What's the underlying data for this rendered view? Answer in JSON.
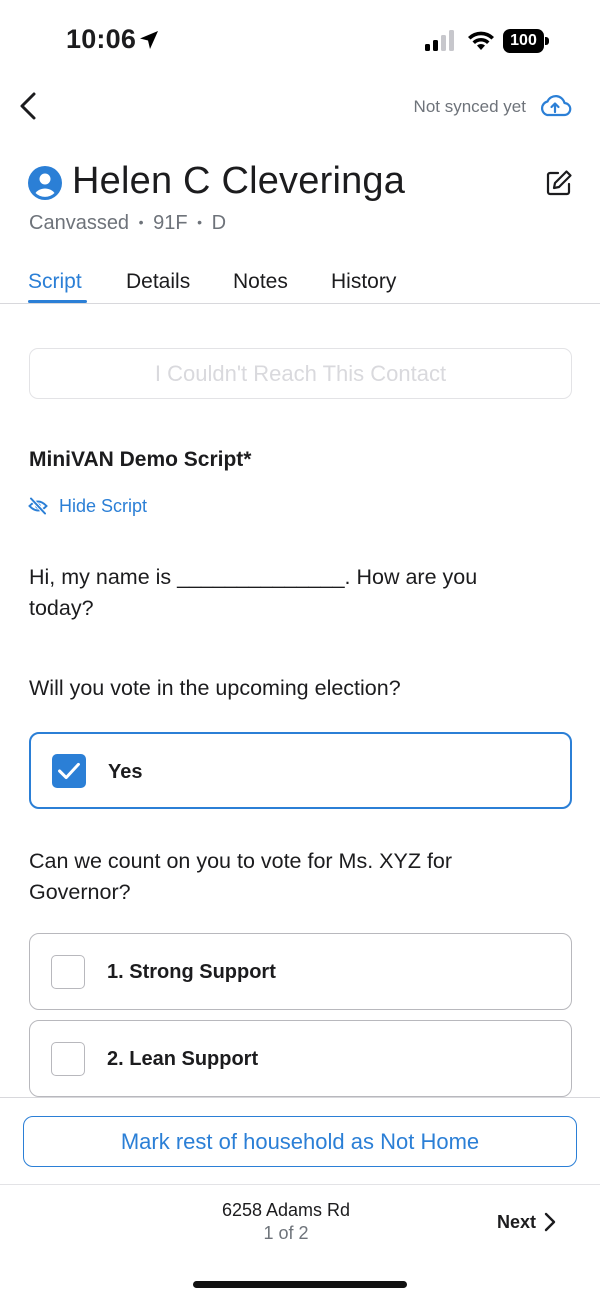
{
  "status_bar": {
    "time": "10:06",
    "battery": "100",
    "location_icon": "location-arrow-icon",
    "signal_icon": "cellular-signal-icon",
    "wifi_icon": "wifi-icon"
  },
  "nav": {
    "back_icon": "chevron-left-icon",
    "sync_status": "Not synced yet",
    "sync_icon": "cloud-upload-icon"
  },
  "contact": {
    "avatar_icon": "user-circle-icon",
    "name": "Helen C Cleveringa",
    "status": "Canvassed",
    "age_gender": "91F",
    "party": "D",
    "separator": "•",
    "edit_icon": "edit-icon"
  },
  "tabs": [
    {
      "label": "Script",
      "active": true
    },
    {
      "label": "Details",
      "active": false
    },
    {
      "label": "Notes",
      "active": false
    },
    {
      "label": "History",
      "active": false
    }
  ],
  "script": {
    "couldnt_reach_label": "I Couldn't Reach This Contact",
    "title": "MiniVAN Demo Script*",
    "hide_label": "Hide Script",
    "hide_icon": "eye-slash-icon",
    "intro_text": "Hi, my name is ______________. How are you today?",
    "question_1": "Will you vote in the upcoming election?",
    "question_1_options": [
      {
        "label": "Yes",
        "checked": true
      }
    ],
    "question_2": "Can we count on you to vote for Ms. XYZ for Governor?",
    "question_2_options": [
      {
        "label": "1. Strong Support",
        "checked": false
      },
      {
        "label": "2. Lean Support",
        "checked": false
      }
    ]
  },
  "footer": {
    "household_button": "Mark rest of household as Not Home",
    "address": "6258 Adams Rd",
    "page": "1 of 2",
    "next_label": "Next",
    "next_icon": "chevron-right-icon"
  },
  "colors": {
    "accent": "#2b7fd6",
    "text_primary": "#1c1c1e",
    "text_secondary": "#6e737a",
    "border": "#b8b8bd"
  }
}
